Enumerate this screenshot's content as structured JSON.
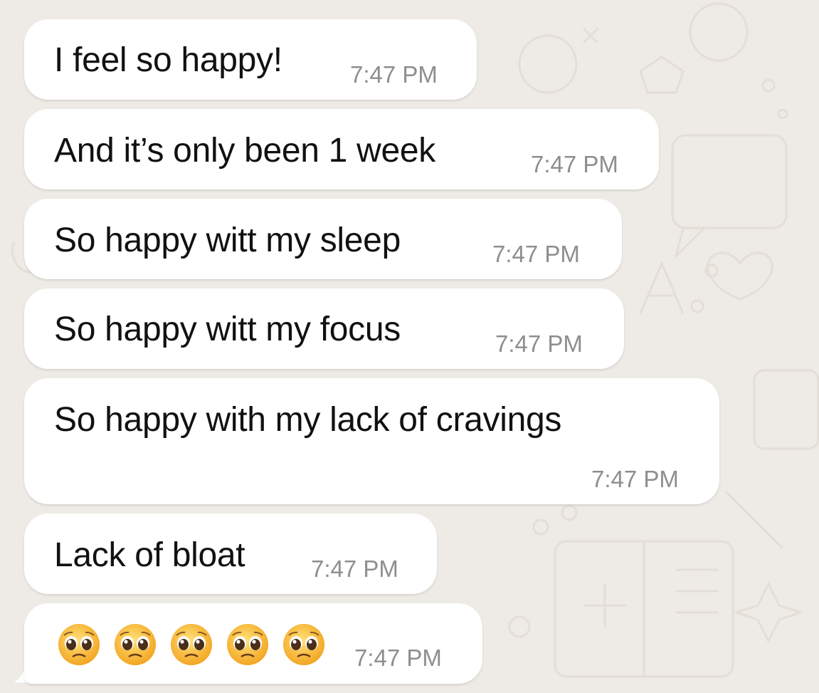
{
  "messages": [
    {
      "text": "I feel so happy!",
      "time": "7:47 PM"
    },
    {
      "text": "And it’s only been 1 week",
      "time": "7:47 PM"
    },
    {
      "text": "So happy witt my sleep",
      "time": "7:47 PM"
    },
    {
      "text": "So happy witt my focus",
      "time": "7:47 PM"
    },
    {
      "text": "So happy with my lack of cravings",
      "time": "7:47 PM"
    },
    {
      "text": "Lack of bloat",
      "time": "7:47 PM"
    },
    {
      "text": "🥺🥺🥺🥺🥺",
      "time": "7:47 PM"
    }
  ],
  "emojis": [
    "pleading-face-emoji",
    "pleading-face-emoji",
    "pleading-face-emoji",
    "pleading-face-emoji",
    "pleading-face-emoji"
  ],
  "colors": {
    "background": "#eeebe6",
    "bubble": "#ffffff",
    "timestamp": "#8e8e8e",
    "text": "#111111"
  }
}
